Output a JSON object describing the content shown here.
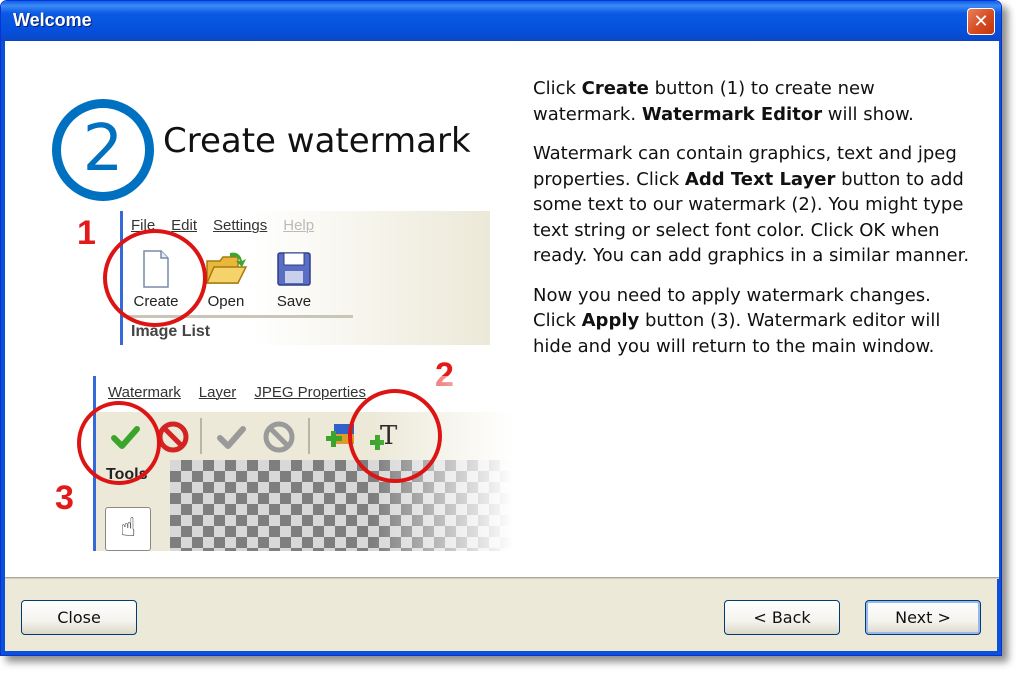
{
  "window": {
    "title": "Welcome",
    "close_glyph": "✕"
  },
  "illustration": {
    "step_number": "2",
    "step_title": "Create watermark",
    "labels": [
      "1",
      "2",
      "3"
    ],
    "screenshot1": {
      "menu": [
        "File",
        "Edit",
        "Settings",
        "Help"
      ],
      "tools": [
        "Create",
        "Open",
        "Save"
      ],
      "panel_title": "Image List"
    },
    "screenshot2": {
      "menu": [
        "Watermark",
        "Layer",
        "JPEG Properties"
      ],
      "panel_title": "Tools",
      "icons": [
        "apply-check-icon",
        "cancel-icon",
        "apply-disabled-icon",
        "cancel-disabled-icon",
        "add-image-layer-icon",
        "add-text-layer-icon",
        "hand-tool-icon"
      ]
    }
  },
  "instructions": {
    "p1": {
      "a": "Click ",
      "b": "Create",
      "c": " button (1) to create new watermark. ",
      "d": "Watermark Editor",
      "e": " will show."
    },
    "p2": {
      "a": "Watermark can contain graphics, text and jpeg properties. Click ",
      "b": "Add Text Layer",
      "c": " button to add some text to our watermark (2). You might type text string or select font color. Click OK when ready. You can add graphics in a similar manner."
    },
    "p3": {
      "a": "Now you need to apply watermark changes. Click ",
      "b": "Apply",
      "c": " button (3). Watermark editor will hide and you will return to the main window."
    }
  },
  "footer": {
    "close_label": "Close",
    "back_label": "< Back",
    "next_label": "Next >"
  },
  "colors": {
    "accent_blue": "#0070c0",
    "highlight_red": "#dd1414",
    "titlebar": "#0551de"
  }
}
